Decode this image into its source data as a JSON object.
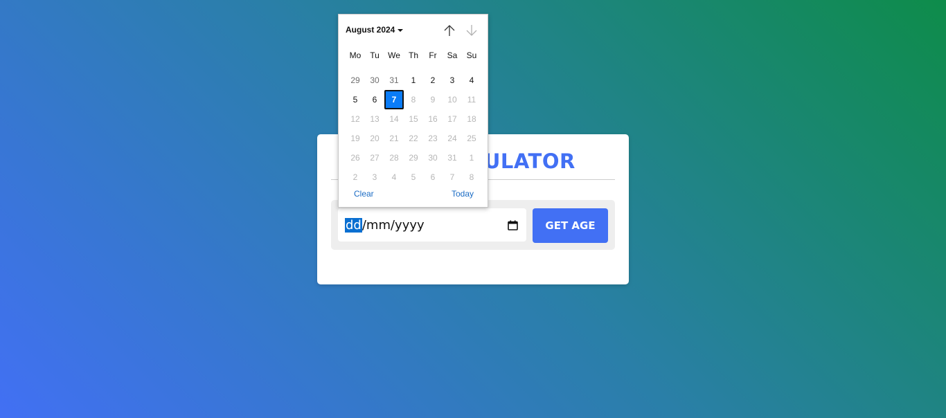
{
  "card": {
    "title": "AGE CALCULATOR",
    "date_input": {
      "day_segment": "dd",
      "rest": "/mm/yyyy",
      "calendar_icon": "calendar-icon"
    },
    "button_label": "GET AGE"
  },
  "picker": {
    "month_label": "August 2024",
    "nav_up_icon": "arrow-up-icon",
    "nav_down_icon": "arrow-down-icon",
    "weekdays": [
      "Mo",
      "Tu",
      "We",
      "Th",
      "Fr",
      "Sa",
      "Su"
    ],
    "weeks": [
      [
        {
          "d": "29",
          "s": "other"
        },
        {
          "d": "30",
          "s": "other"
        },
        {
          "d": "31",
          "s": "other"
        },
        {
          "d": "1",
          "s": "normal"
        },
        {
          "d": "2",
          "s": "normal"
        },
        {
          "d": "3",
          "s": "normal"
        },
        {
          "d": "4",
          "s": "normal"
        }
      ],
      [
        {
          "d": "5",
          "s": "normal"
        },
        {
          "d": "6",
          "s": "normal"
        },
        {
          "d": "7",
          "s": "selected"
        },
        {
          "d": "8",
          "s": "disabled"
        },
        {
          "d": "9",
          "s": "disabled"
        },
        {
          "d": "10",
          "s": "disabled"
        },
        {
          "d": "11",
          "s": "disabled"
        }
      ],
      [
        {
          "d": "12",
          "s": "disabled"
        },
        {
          "d": "13",
          "s": "disabled"
        },
        {
          "d": "14",
          "s": "disabled"
        },
        {
          "d": "15",
          "s": "disabled"
        },
        {
          "d": "16",
          "s": "disabled"
        },
        {
          "d": "17",
          "s": "disabled"
        },
        {
          "d": "18",
          "s": "disabled"
        }
      ],
      [
        {
          "d": "19",
          "s": "disabled"
        },
        {
          "d": "20",
          "s": "disabled"
        },
        {
          "d": "21",
          "s": "disabled"
        },
        {
          "d": "22",
          "s": "disabled"
        },
        {
          "d": "23",
          "s": "disabled"
        },
        {
          "d": "24",
          "s": "disabled"
        },
        {
          "d": "25",
          "s": "disabled"
        }
      ],
      [
        {
          "d": "26",
          "s": "disabled"
        },
        {
          "d": "27",
          "s": "disabled"
        },
        {
          "d": "28",
          "s": "disabled"
        },
        {
          "d": "29",
          "s": "disabled"
        },
        {
          "d": "30",
          "s": "disabled"
        },
        {
          "d": "31",
          "s": "disabled"
        },
        {
          "d": "1",
          "s": "disabled"
        }
      ],
      [
        {
          "d": "2",
          "s": "disabled"
        },
        {
          "d": "3",
          "s": "disabled"
        },
        {
          "d": "4",
          "s": "disabled"
        },
        {
          "d": "5",
          "s": "disabled"
        },
        {
          "d": "6",
          "s": "disabled"
        },
        {
          "d": "7",
          "s": "disabled"
        },
        {
          "d": "8",
          "s": "disabled"
        }
      ]
    ],
    "clear_label": "Clear",
    "today_label": "Today"
  },
  "colors": {
    "accent": "#4270f4",
    "selected_day": "#0a7cf7",
    "link": "#1a6bc4",
    "background_start": "#4270f4",
    "background_end": "#0e8c4a"
  }
}
